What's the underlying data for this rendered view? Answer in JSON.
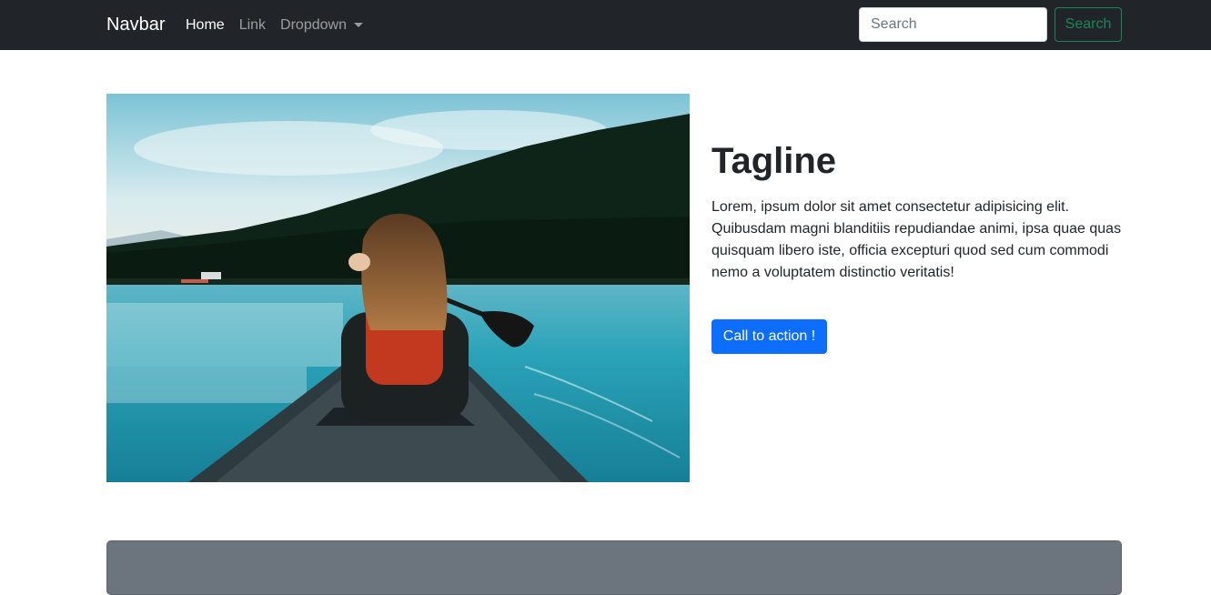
{
  "navbar": {
    "brand": "Navbar",
    "links": [
      {
        "label": "Home",
        "active": true
      },
      {
        "label": "Link",
        "active": false
      },
      {
        "label": "Dropdown",
        "active": false,
        "has_dropdown": true
      }
    ],
    "search": {
      "placeholder": "Search",
      "value": "",
      "button_label": "Search"
    }
  },
  "hero": {
    "image_alt": "Woman paddling a canoe on a turquoise lake",
    "tagline": "Tagline",
    "text": "Lorem, ipsum dolor sit amet consectetur adipisicing elit. Quibusdam magni blanditiis repudiandae animi, ipsa quae quas quisquam libero iste, officia excepturi quod sed cum commodi nemo a voluptatem distinctio veritatis!",
    "cta_label": "Call to action !"
  },
  "colors": {
    "navbar_bg": "#212529",
    "primary": "#0d6efd",
    "success": "#198754",
    "secondary": "#6c757d"
  }
}
